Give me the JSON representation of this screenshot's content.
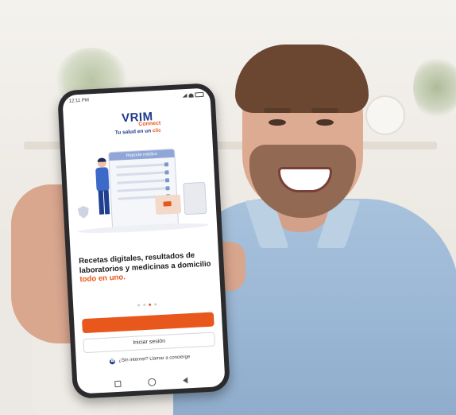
{
  "status_bar": {
    "time": "12:11 PM"
  },
  "app": {
    "brand": "VRIM",
    "brand_suffix": "Connect",
    "tagline_main": "Tu salud en un",
    "tagline_accent": "clic",
    "illustration_caption": "Reporte médico",
    "headline_main": "Recetas digitales, resultados de laboratorios y medicinas a domicilio",
    "headline_accent": "todo en uno.",
    "carousel": {
      "total": 4,
      "active_index": 2
    },
    "primary_button_label": "",
    "login_button_label": "Iniciar sesión",
    "concierge_text": "¿Sin internet? Llamar a concierge"
  },
  "colors": {
    "accent": "#e8571c",
    "brand": "#1e3a8a"
  },
  "icons": [
    "signal-icon",
    "wifi-icon",
    "battery-icon",
    "phone-icon",
    "nav-recents-icon",
    "nav-home-icon",
    "nav-back-icon"
  ]
}
